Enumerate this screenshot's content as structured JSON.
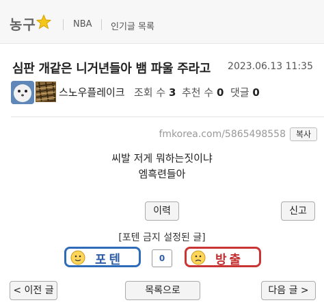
{
  "board": {
    "name": "농구",
    "links": [
      "NBA",
      "인기글 목록"
    ]
  },
  "post": {
    "title": "심판 개같은 니거년들아 뱀 파울 주라고",
    "date": "2023.06.13 11:35",
    "author": "스노우플레이크",
    "stats": {
      "views_label": "조회 수",
      "views": "3",
      "recommend_label": "추천 수",
      "recommend": "0",
      "comments_label": "댓글",
      "comments": "0"
    },
    "url": "fmkorea.com/5865498558",
    "copy_label": "복사",
    "body": [
      "씨발 저게 뭐하는짓이냐",
      "엠흑련들아"
    ]
  },
  "actions": {
    "history": "이력",
    "report": "신고",
    "locked_note": "[포텐 금지 설정된 글]",
    "vote_up": "포텐",
    "vote_count": "0",
    "vote_down": "방출",
    "prev": "< 이전 글",
    "list": "목록으로",
    "next": "다음 글 >"
  },
  "colors": {
    "vote_up": "#2e6bb8",
    "vote_down": "#c93434",
    "star": "#f5c518"
  }
}
